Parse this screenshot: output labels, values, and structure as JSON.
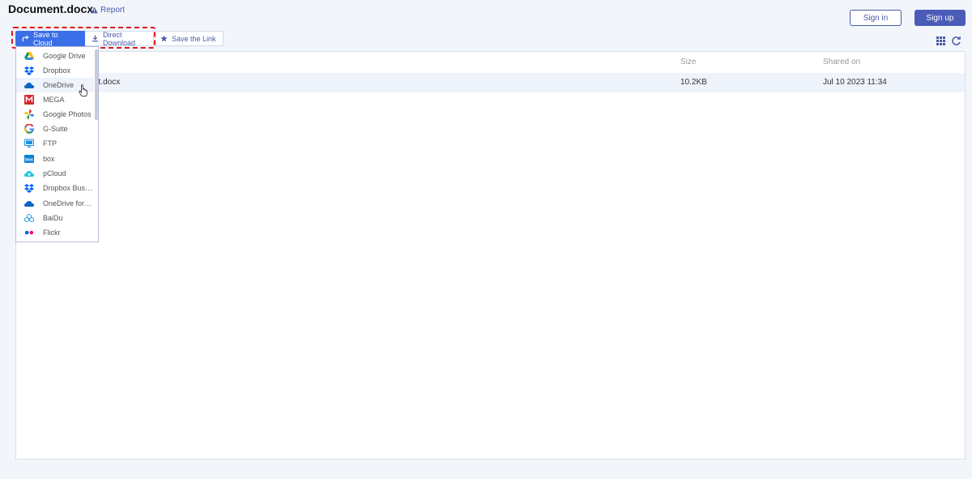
{
  "header": {
    "title": "Document.docx",
    "report_label": "Report",
    "signin_label": "Sign in",
    "signup_label": "Sign up"
  },
  "toolbar": {
    "save_to_cloud": "Save to Cloud",
    "direct_download": "Direct Download",
    "save_the_link": "Save the Link"
  },
  "table": {
    "columns": {
      "size": "Size",
      "shared_on": "Shared on"
    },
    "rows": [
      {
        "name": "nt.docx",
        "size": "10.2KB",
        "shared_on": "Jul 10 2023 11:34"
      }
    ]
  },
  "dropdown": {
    "items": [
      {
        "label": "Google Drive",
        "icon": "google-drive-icon"
      },
      {
        "label": "Dropbox",
        "icon": "dropbox-icon"
      },
      {
        "label": "OneDrive",
        "icon": "onedrive-icon"
      },
      {
        "label": "MEGA",
        "icon": "mega-icon"
      },
      {
        "label": "Google Photos",
        "icon": "google-photos-icon"
      },
      {
        "label": "G-Suite",
        "icon": "g-suite-icon"
      },
      {
        "label": "FTP",
        "icon": "ftp-icon"
      },
      {
        "label": "box",
        "icon": "box-icon"
      },
      {
        "label": "pCloud",
        "icon": "pcloud-icon"
      },
      {
        "label": "Dropbox Business",
        "icon": "dropbox-business-icon"
      },
      {
        "label": "OneDrive for Business",
        "icon": "onedrive-business-icon"
      },
      {
        "label": "BaiDu",
        "icon": "baidu-icon"
      },
      {
        "label": "Flickr",
        "icon": "flickr-icon"
      }
    ]
  },
  "colors": {
    "accent": "#3b6fe8",
    "brand": "#4b5cb8",
    "highlight_border": "#e0161e"
  }
}
